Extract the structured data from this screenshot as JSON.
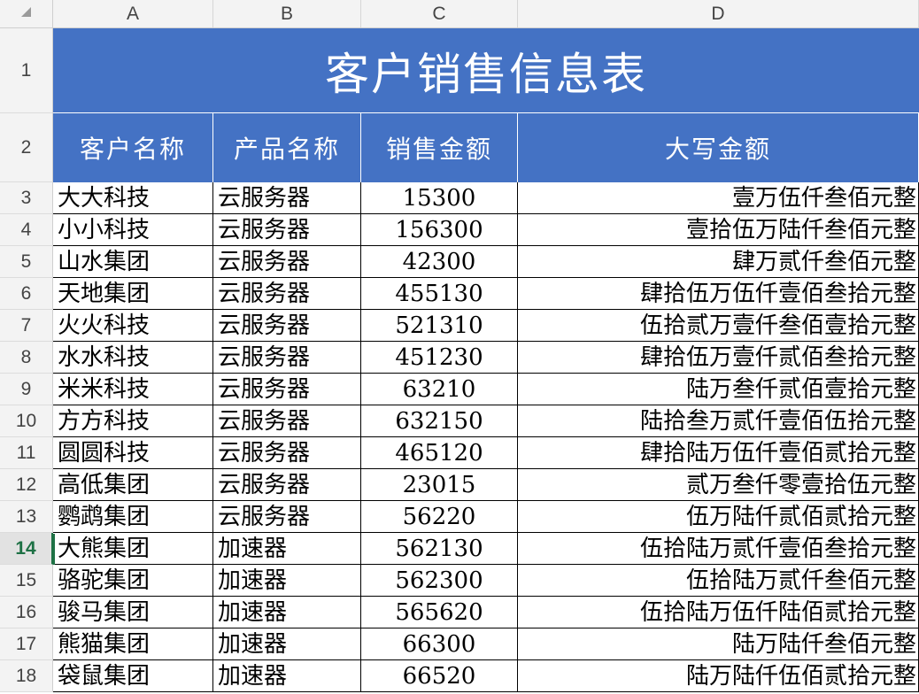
{
  "columns": [
    "A",
    "B",
    "C",
    "D"
  ],
  "rows": [
    "1",
    "2",
    "3",
    "4",
    "5",
    "6",
    "7",
    "8",
    "9",
    "10",
    "11",
    "12",
    "13",
    "14",
    "15",
    "16",
    "17",
    "18"
  ],
  "selected_row": "14",
  "title": "客户销售信息表",
  "headers": [
    "客户名称",
    "产品名称",
    "销售金额",
    "大写金额"
  ],
  "records": [
    [
      "大大科技",
      "云服务器",
      "15300",
      "壹万伍仟叁佰元整"
    ],
    [
      "小小科技",
      "云服务器",
      "156300",
      "壹拾伍万陆仟叁佰元整"
    ],
    [
      "山水集团",
      "云服务器",
      "42300",
      "肆万贰仟叁佰元整"
    ],
    [
      "天地集团",
      "云服务器",
      "455130",
      "肆拾伍万伍仟壹佰叁拾元整"
    ],
    [
      "火火科技",
      "云服务器",
      "521310",
      "伍拾贰万壹仟叁佰壹拾元整"
    ],
    [
      "水水科技",
      "云服务器",
      "451230",
      "肆拾伍万壹仟贰佰叁拾元整"
    ],
    [
      "米米科技",
      "云服务器",
      "63210",
      "陆万叁仟贰佰壹拾元整"
    ],
    [
      "方方科技",
      "云服务器",
      "632150",
      "陆拾叁万贰仟壹佰伍拾元整"
    ],
    [
      "圆圆科技",
      "云服务器",
      "465120",
      "肆拾陆万伍仟壹佰贰拾元整"
    ],
    [
      "高低集团",
      "云服务器",
      "23015",
      "贰万叁仟零壹拾伍元整"
    ],
    [
      "鹦鹉集团",
      "云服务器",
      "56220",
      "伍万陆仟贰佰贰拾元整"
    ],
    [
      "大熊集团",
      "加速器",
      "562130",
      "伍拾陆万贰仟壹佰叁拾元整"
    ],
    [
      "骆驼集团",
      "加速器",
      "562300",
      "伍拾陆万贰仟叁佰元整"
    ],
    [
      "骏马集团",
      "加速器",
      "565620",
      "伍拾陆万伍仟陆佰贰拾元整"
    ],
    [
      "熊猫集团",
      "加速器",
      "66300",
      "陆万陆仟叁佰元整"
    ],
    [
      "袋鼠集团",
      "加速器",
      "66520",
      "陆万陆仟伍佰贰拾元整"
    ]
  ],
  "colors": {
    "header_fill": "#4472c4",
    "header_text": "#ffffff",
    "selected_row_accent": "#1e7145"
  },
  "icons": {
    "select_all": "select-all-triangle-icon"
  }
}
